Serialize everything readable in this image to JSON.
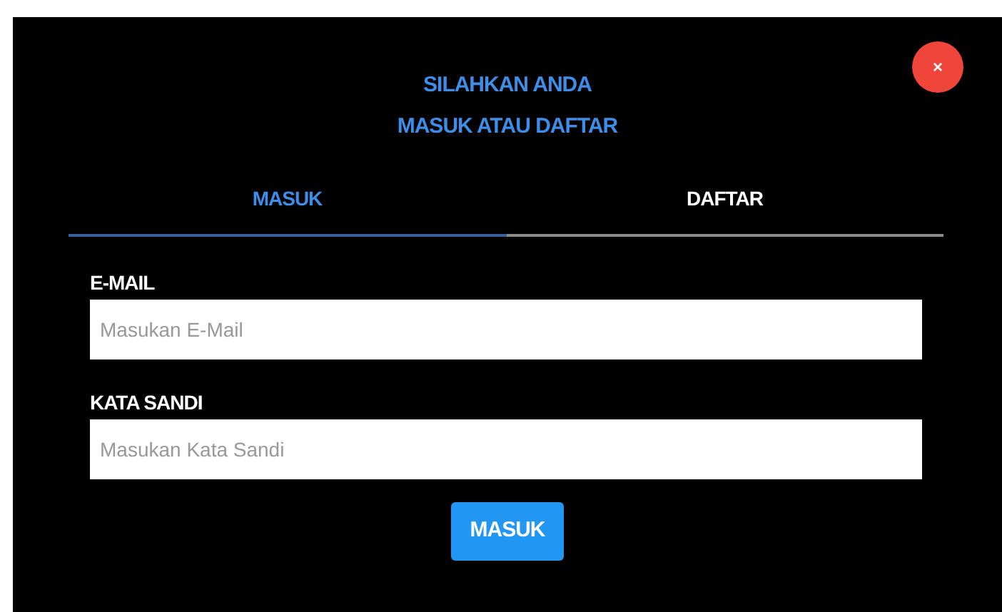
{
  "close_button": {
    "label": "×"
  },
  "title_lines": [
    "SILAHKAN ANDA",
    "MASUK ATAU DAFTAR"
  ],
  "tabs": [
    {
      "label": "MASUK",
      "selected": true
    },
    {
      "label": "DAFTAR",
      "selected": false
    }
  ],
  "fields": [
    {
      "label": "E-MAIL",
      "placeholder": "Masukan E-Mail"
    },
    {
      "label": "KATA SANDI",
      "placeholder": "Masukan Kata Sandi"
    }
  ],
  "submit_button": {
    "label": "MASUK"
  }
}
